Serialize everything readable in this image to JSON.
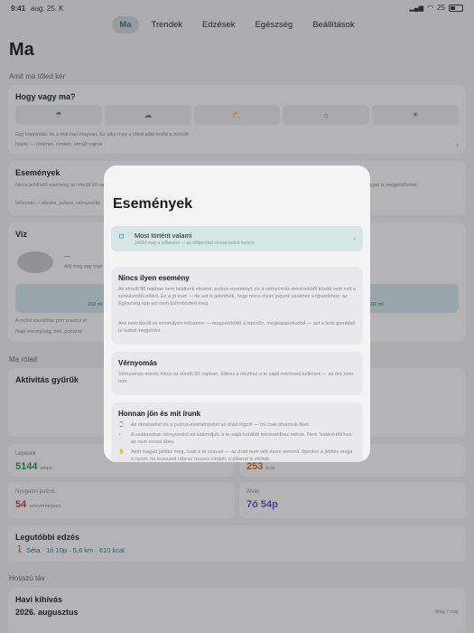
{
  "status": {
    "time": "9:41",
    "date": "aug. 25. K",
    "battery": "25"
  },
  "tabs": [
    "Ma",
    "Trendek",
    "Edzések",
    "Egészség",
    "Beállítások"
  ],
  "page_title": "Ma",
  "sections": {
    "today_ask": "Amit ma tőled kér",
    "about_you": "Ma rólad",
    "long_term": "Hosszú táv"
  },
  "mood": {
    "title": "Hogy vagy ma?",
    "hint": "Egy koppintás, és a mai nap megvan. Ez adja meg a tőled adat mellé a mércét.",
    "link": "Napló — történet, címkék, elmúlt napok"
  },
  "events_card": {
    "title": "Események",
    "text": "Nincs jelölhető esemény az elmúlt 90 napban. Ha elesel, vagy nagyon szokatlan pulzust érzel, jelöld, és ha valami olyan történt, amit semmi nem rögzített, azt magad is megjelölheted.",
    "link": "Idővonal — elesés, pulzus, vérnyomás"
  },
  "water": {
    "title": "Víz",
    "dash": "—",
    "sub": "Adj meg egy napi célt",
    "quick_left": "250 ml",
    "quick_right": "500 ml",
    "note": "A mobil kiszállítás pen pusztul el",
    "link": "Napi mennyiség, heti, poharak"
  },
  "activity": {
    "title": "Aktivitás gyűrűk"
  },
  "metrics": [
    {
      "label": "Lépések",
      "value": "5144",
      "unit": "steps"
    },
    {
      "label": "",
      "value": "253",
      "unit": "kcal"
    },
    {
      "label": "Nyugalmi pulzus",
      "value": "54",
      "unit": "szívverés/perc"
    },
    {
      "label": "Alvás",
      "value": "7ó 54p",
      "unit": ""
    }
  ],
  "last_workout": {
    "title": "Legutóbbi edzés",
    "detail": "Séta · 1ó 10p · 5,6 km · 610 kcal"
  },
  "monthly": {
    "title": "Havi kihívás",
    "month": "2026. augusztus",
    "remaining": "Még 7 nap"
  },
  "modal": {
    "title": "Események",
    "now_title": "Most történt valami",
    "now_sub": "Jelöld meg a pillanatot — az időpontból vissza tudod festeni.",
    "none_title": "Nincs ilyen esemény",
    "none_p1": "Az elmúlt 90 napban nem találtunk elesést, pulzus-eseményt, és a vérnyomás-mérésekből között sem volt a szokásostól eltérő. Ez a jó eset — de azt is jelentheti, hogy nincs olyan jogunk ezekhez a típusokhoz: az Egészség app ezt nem különbözteti meg.",
    "none_p2": "Ami nem került rá semmilyen műszerre — megszédültél a lépcsőn, megkapaszkodtál — azt a fenti gombbal te tudod megjelölni.",
    "bp_title": "Vérnyomás",
    "bp_text": "Vérnyomás-mérés nincs az elmúlt 90 napban. Ehhez a részhez a te saját méréseid kellenek — az óra nem mér.",
    "src_title": "Honnan jön és mit írunk",
    "src_1": "Az eleséseket és a pulzus-eseményeket az órád rögzíti — mi csak olvassuk őket.",
    "src_2": "A szakaszban vérnyomást mi számoljuk, a te saját korábbi méréseidhez mérve. Nem ‘határérték’hez: az nem orvosi ábra.",
    "src_3": "Amit magad jelölsz meg, csak a te szavad — az órád nem vett észre semmit. Ilyenkor a jelölés maga a nyom: ha leveszed róla az összes címkét, a pillanat is eltűnik."
  }
}
